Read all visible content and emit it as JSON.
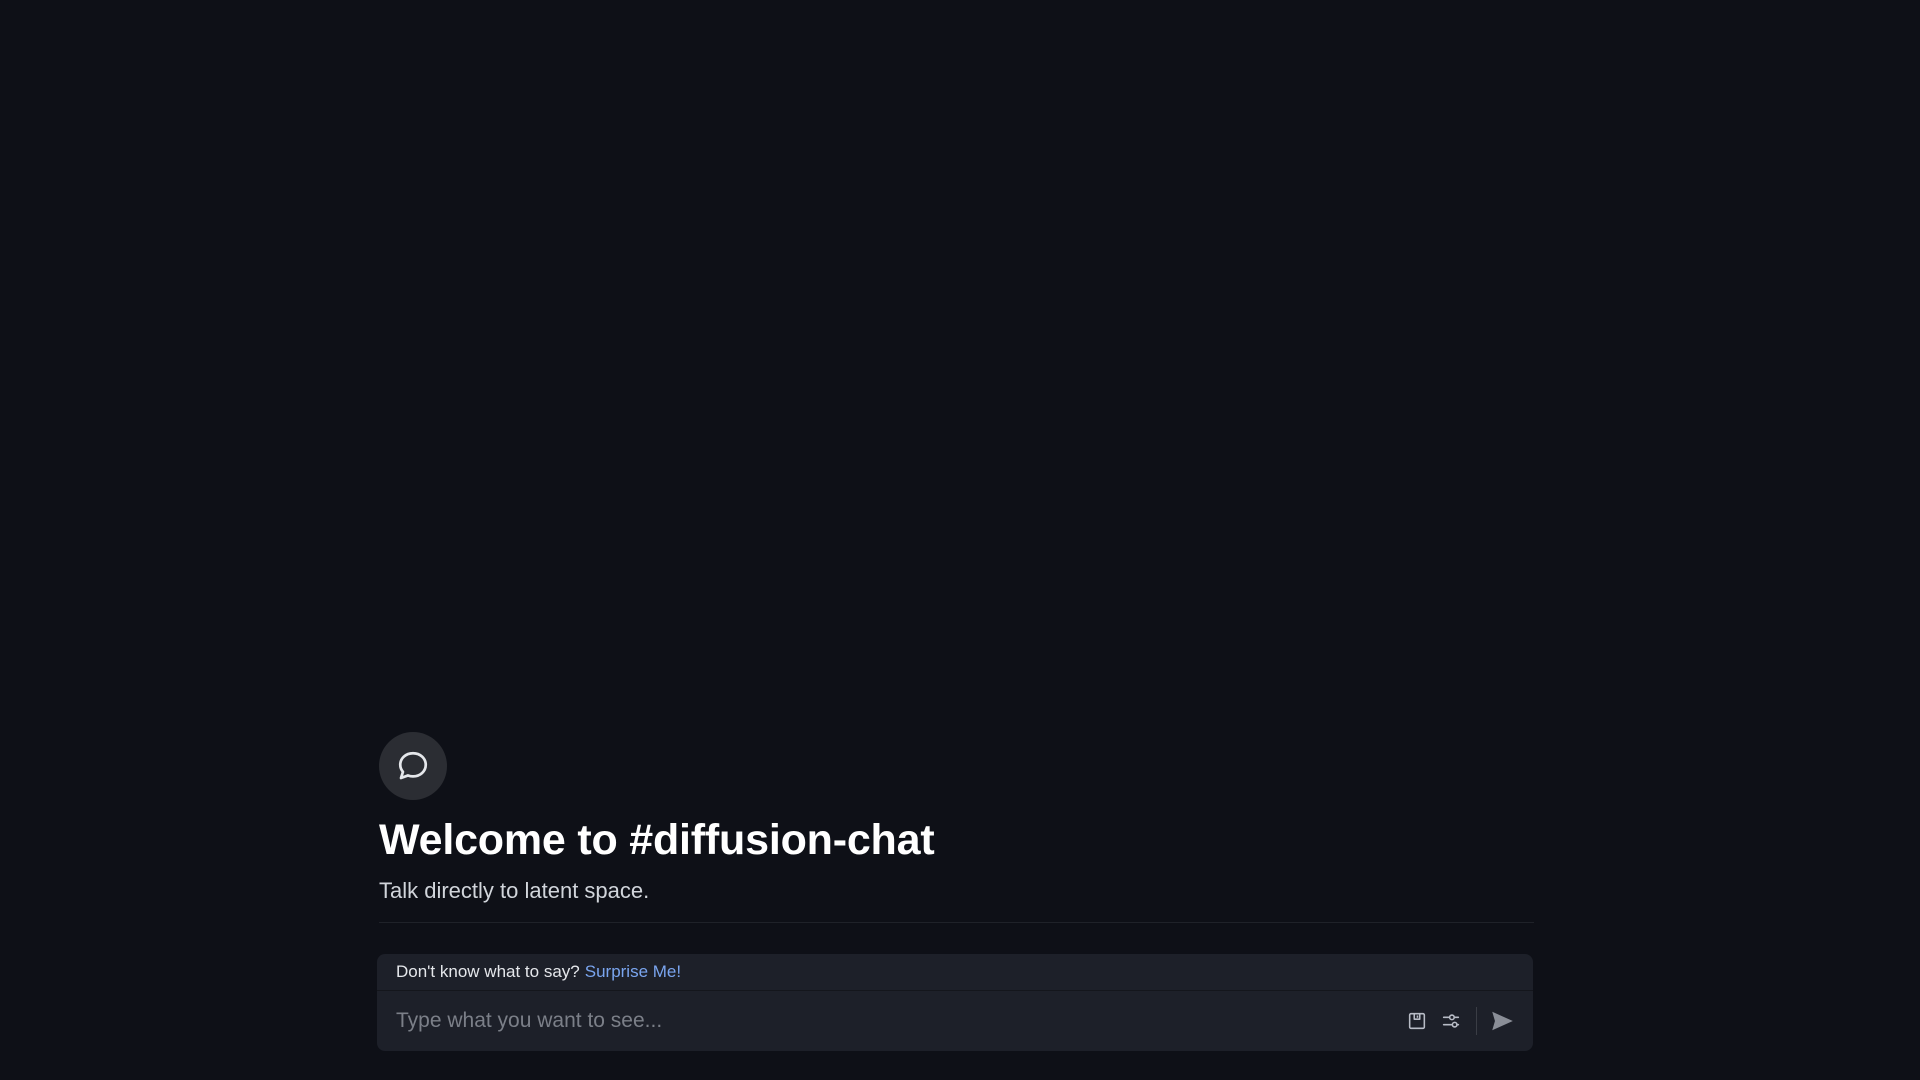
{
  "channel": {
    "icon": "chat-bubble-icon",
    "title": "Welcome to #diffusion-chat",
    "subtitle": "Talk directly to latent space."
  },
  "composer": {
    "hint_text": "Don't know what to say?",
    "hint_link": "Surprise Me!",
    "input_value": "",
    "input_placeholder": "Type what you want to see...",
    "icons": [
      "save-icon",
      "sliders-icon",
      "send-icon"
    ]
  },
  "colors": {
    "background": "#0e1017",
    "composer": "#1d2029",
    "link": "#7aa5ef"
  }
}
